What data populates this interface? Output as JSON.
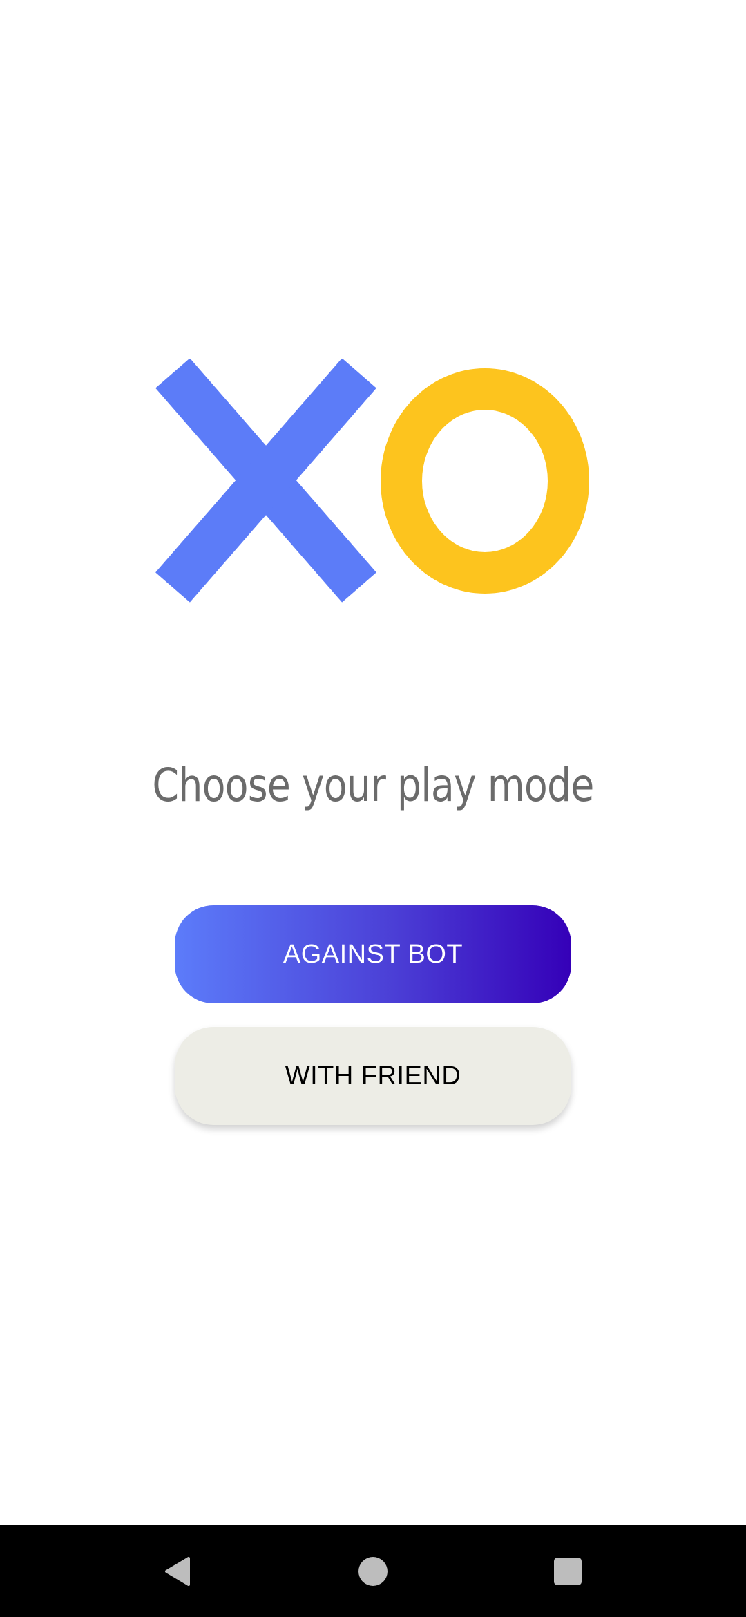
{
  "logo": {
    "x_letter": "X",
    "o_letter": "O",
    "x_color": "#5c7cf8",
    "o_color": "#fdc41e"
  },
  "main": {
    "prompt": "Choose your play mode",
    "buttons": {
      "against_bot": "AGAINST BOT",
      "with_friend": "WITH FRIEND"
    }
  },
  "colors": {
    "bot_gradient_start": "#5c7cfa",
    "bot_gradient_end": "#3500b8",
    "friend_button_bg": "#edede6",
    "prompt_text": "#6b6b6b"
  },
  "nav_bar": {
    "icons": [
      "back-icon",
      "home-icon",
      "recents-icon"
    ]
  }
}
